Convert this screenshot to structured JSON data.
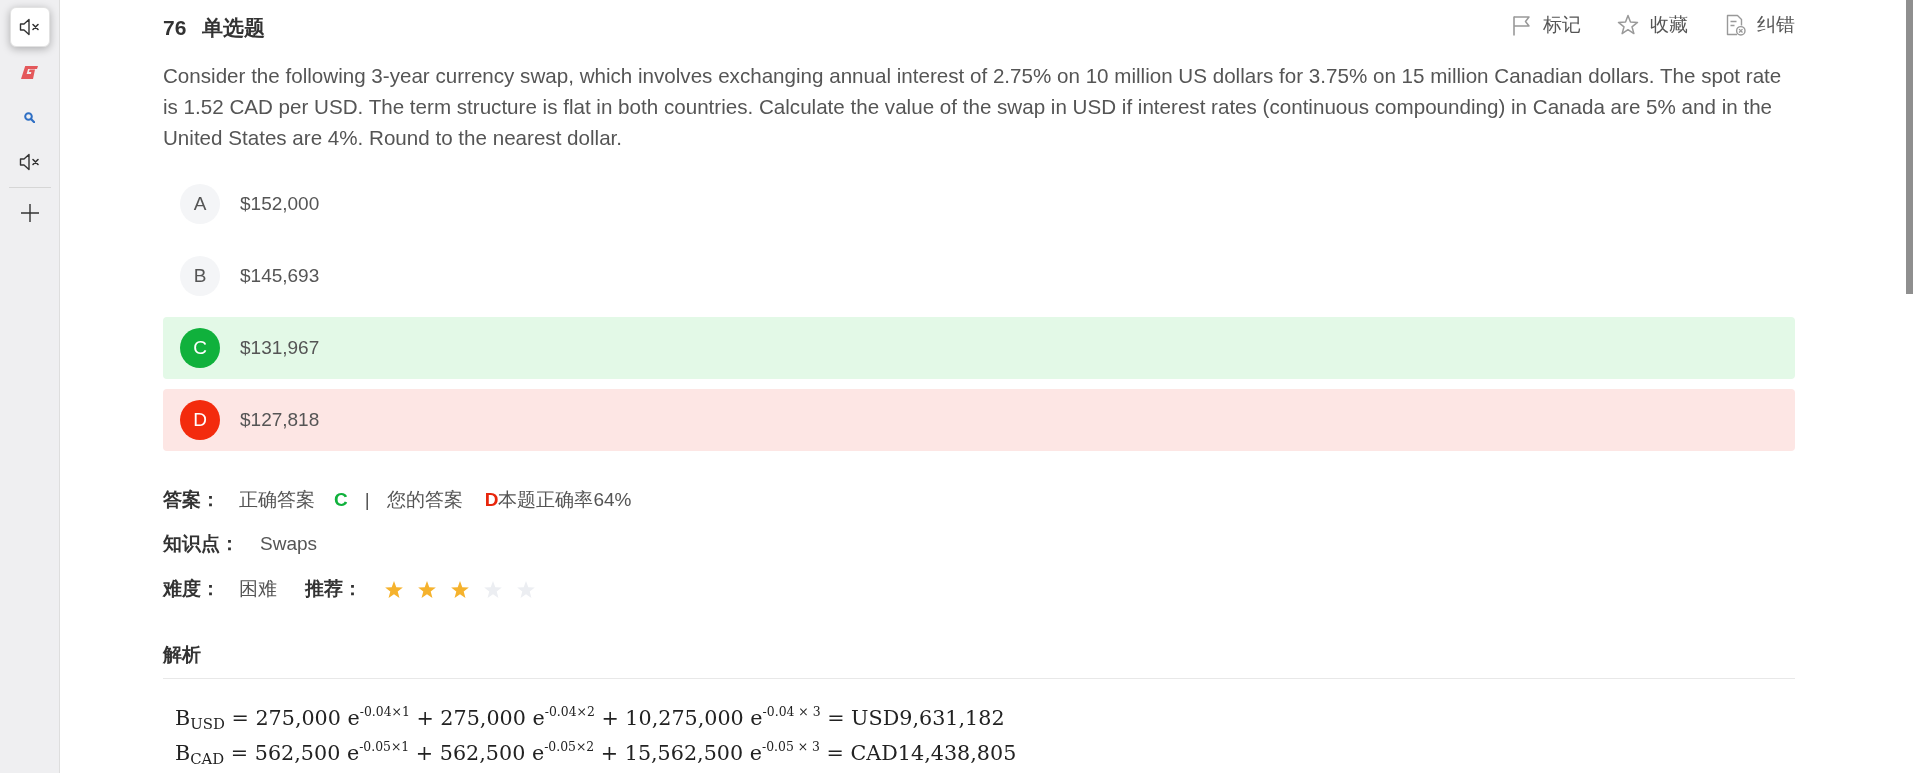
{
  "sidebar": {
    "tools": [
      {
        "kind": "speaker",
        "selected": true
      },
      {
        "kind": "logo",
        "selected": false
      },
      {
        "kind": "search",
        "selected": false
      },
      {
        "kind": "speaker",
        "selected": false
      }
    ]
  },
  "question": {
    "number": "76",
    "type": "单选题",
    "actions": [
      {
        "kind": "flag",
        "label": "标记"
      },
      {
        "kind": "star",
        "label": "收藏"
      },
      {
        "kind": "report",
        "label": "纠错"
      }
    ],
    "text": "Consider the following 3-year currency swap, which involves exchanging annual interest of 2.75% on 10 million US dollars for 3.75% on 15 million Canadian dollars. The spot rate is 1.52 CAD per USD. The term structure is flat in both countries. Calculate the value of the swap in USD if interest rates (continuous compounding) in Canada are 5% and in the United States are 4%. Round to the nearest dollar."
  },
  "options": [
    {
      "letter": "A",
      "text": "$152,000",
      "correct": false,
      "wrong": false
    },
    {
      "letter": "B",
      "text": "$145,693",
      "correct": false,
      "wrong": false
    },
    {
      "letter": "C",
      "text": "$131,967",
      "correct": true,
      "wrong": false
    },
    {
      "letter": "D",
      "text": "$127,818",
      "correct": false,
      "wrong": true
    }
  ],
  "answer": {
    "label": "答案：",
    "correct_label": "正确答案",
    "correct_option": "C",
    "separator": "|",
    "user_label": "您的答案",
    "user_option": "D",
    "user_correct": false,
    "accuracy": "本题正确率64%"
  },
  "knowledge": {
    "label": "知识点：",
    "value": "Swaps"
  },
  "difficulty": {
    "label": "难度：",
    "value": "困难"
  },
  "recommendation": {
    "label": "推荐：",
    "stars": 3
  },
  "analysis": {
    "title": "解析",
    "formulas": [
      "B$_{USD}$ = 275,000 e$^{-0.04×1}$ + 275,000 e$^{-0.04×2}$ + 10,275,000 e$^{-0.04 × 3}$ = USD9,631,182",
      "B$_{CAD}$ = 562,500 e$^{-0.05×1}$ + 562,500 e$^{-0.05×2}$ + 15,562,500 e$^{-0.05 × 3}$ = CAD14,438,805"
    ]
  }
}
